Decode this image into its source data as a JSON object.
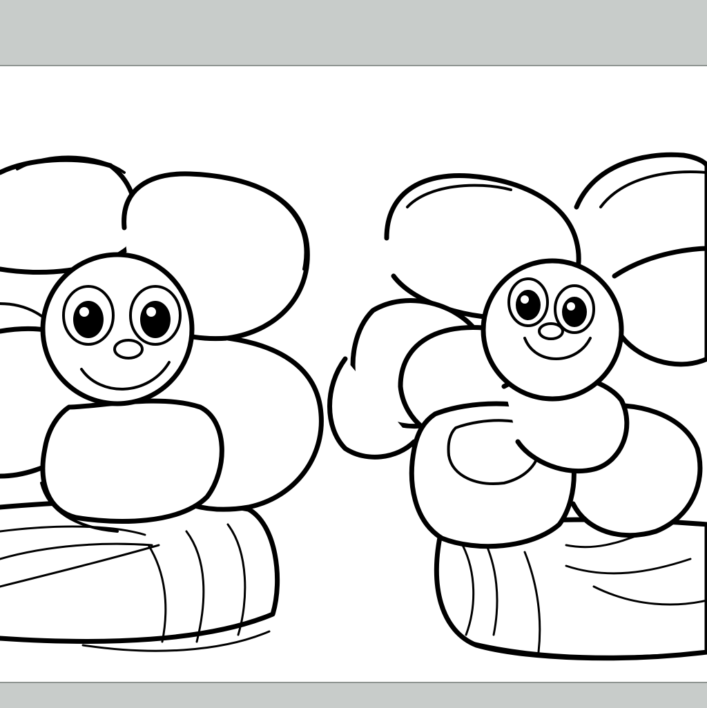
{
  "palette": {
    "band": "#c8ccca",
    "band_edge": "#8e9491",
    "paper": "#ffffff",
    "ink": "#000000"
  },
  "illustration": {
    "style": "coloring-page line art",
    "subjects": [
      "smiling-flower-left",
      "smiling-flower-right"
    ]
  }
}
